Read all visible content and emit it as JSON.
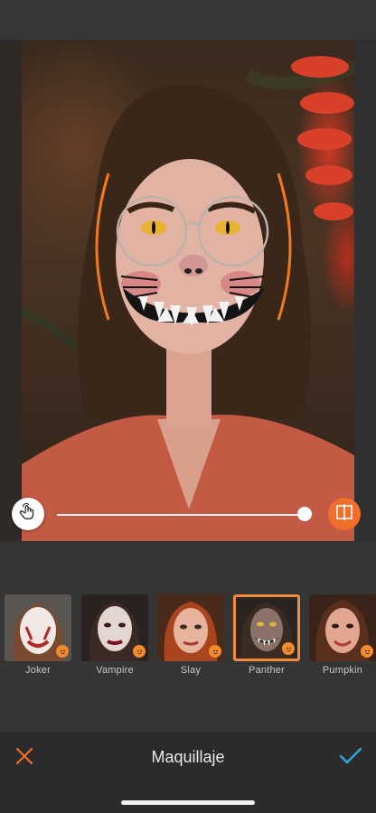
{
  "colors": {
    "accent": "#f26f2b",
    "confirm": "#2fa8e0",
    "background": "#353535",
    "bottom_bar": "#2b2b2b"
  },
  "slider": {
    "value_fraction": 0.97,
    "left_icon": "hand-touch-icon",
    "right_icon": "compare-split-icon"
  },
  "filters": [
    {
      "label": "Joker",
      "selected": false,
      "badge_icon": "pumpkin-icon"
    },
    {
      "label": "Vampire",
      "selected": false,
      "badge_icon": "pumpkin-icon"
    },
    {
      "label": "Slay",
      "selected": false,
      "badge_icon": "pumpkin-icon"
    },
    {
      "label": "Panther",
      "selected": true,
      "badge_icon": "pumpkin-icon"
    },
    {
      "label": "Pumpkin",
      "selected": false,
      "badge_icon": "pumpkin-icon"
    }
  ],
  "bottom_bar": {
    "title": "Maquillaje",
    "cancel_icon": "close-icon",
    "confirm_icon": "checkmark-icon"
  }
}
